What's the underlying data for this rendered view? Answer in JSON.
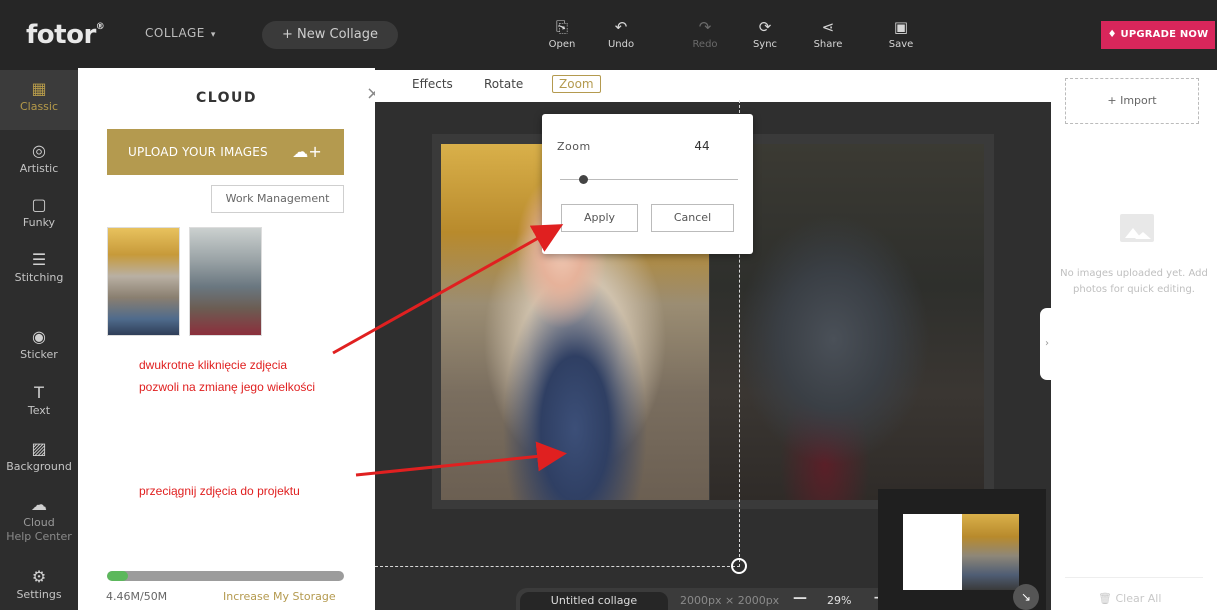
{
  "topbar": {
    "logo": "fotor",
    "logo_mark": "®",
    "mode_menu": "COLLAGE",
    "new_collage": "New Collage",
    "tools": [
      {
        "label": "Open",
        "icon": "open-icon"
      },
      {
        "label": "Undo",
        "icon": "undo-icon"
      },
      {
        "label": "Redo",
        "icon": "redo-icon"
      },
      {
        "label": "Sync",
        "icon": "sync-icon"
      },
      {
        "label": "Share",
        "icon": "share-icon"
      },
      {
        "label": "Save",
        "icon": "save-icon"
      }
    ],
    "upgrade": "UPGRADE NOW"
  },
  "leftnav": {
    "items": [
      {
        "label": "Classic",
        "icon": "grid-icon"
      },
      {
        "label": "Artistic",
        "icon": "artistic-icon"
      },
      {
        "label": "Funky",
        "icon": "funky-icon"
      },
      {
        "label": "Stitching",
        "icon": "stitching-icon"
      },
      {
        "label": "Sticker",
        "icon": "sticker-icon"
      },
      {
        "label": "Text",
        "icon": "text-icon"
      },
      {
        "label": "Background",
        "icon": "background-icon"
      },
      {
        "label": "Cloud",
        "icon": "cloud-icon"
      },
      {
        "label": "Help Center",
        "icon": "help-icon"
      },
      {
        "label": "Settings",
        "icon": "settings-icon"
      }
    ]
  },
  "cloud": {
    "title": "CLOUD",
    "upload_label": "UPLOAD YOUR IMAGES",
    "work_management": "Work Management",
    "annotation_1_line1": "dwukrotne kliknięcie zdjęcia",
    "annotation_1_line2": "pozwoli na zmianę jego wielkości",
    "annotation_2": "przeciągnij zdjęcia do projektu",
    "storage_used": "4.46M/50M",
    "storage_fraction": 0.09,
    "increase_storage": "Increase My Storage"
  },
  "subtoolbar": {
    "tabs": [
      "Effects",
      "Rotate",
      "Zoom"
    ]
  },
  "zoom_popup": {
    "label": "Zoom",
    "value": "44",
    "apply": "Apply",
    "cancel": "Cancel"
  },
  "status": {
    "doc_name": "Untitled collage",
    "doc_size": "2000px × 2000px",
    "zoom_minus": "—",
    "zoom_pct": "29%",
    "zoom_plus": "+"
  },
  "rightpanel": {
    "import": "Import",
    "empty_text": "No images uploaded yet. Add photos for quick editing.",
    "clear_all": "Clear All"
  },
  "colors": {
    "accent_gold": "#b49a4f",
    "upgrade_pink": "#d8265b",
    "annotation_red": "#e02020",
    "storage_green": "#5cb85c"
  }
}
